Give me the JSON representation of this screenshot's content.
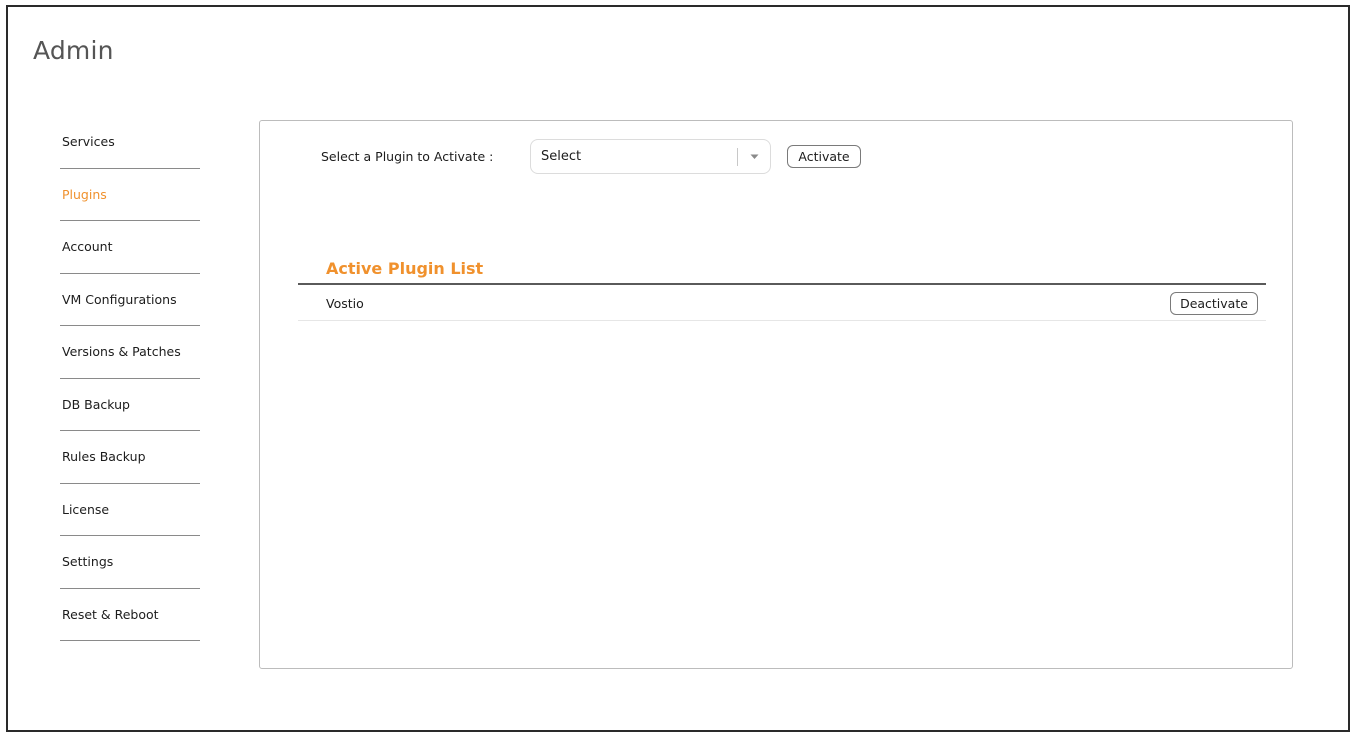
{
  "page": {
    "title": "Admin"
  },
  "sidebar": {
    "items": [
      {
        "label": "Services",
        "active": false
      },
      {
        "label": "Plugins",
        "active": true
      },
      {
        "label": "Account",
        "active": false
      },
      {
        "label": "VM Configurations",
        "active": false
      },
      {
        "label": "Versions & Patches",
        "active": false
      },
      {
        "label": "DB Backup",
        "active": false
      },
      {
        "label": "Rules Backup",
        "active": false
      },
      {
        "label": "License",
        "active": false
      },
      {
        "label": "Settings",
        "active": false
      },
      {
        "label": "Reset & Reboot",
        "active": false
      }
    ]
  },
  "activate": {
    "label": "Select a Plugin to Activate :",
    "select_value": "Select",
    "caret_icon": "chevron-down-icon",
    "button_label": "Activate"
  },
  "active_plugins": {
    "title": "Active Plugin List",
    "rows": [
      {
        "name": "Vostio",
        "action_label": "Deactivate"
      }
    ]
  },
  "colors": {
    "accent": "#f0912d",
    "text": "#1c1c1c",
    "border": "#bcbcbc"
  }
}
